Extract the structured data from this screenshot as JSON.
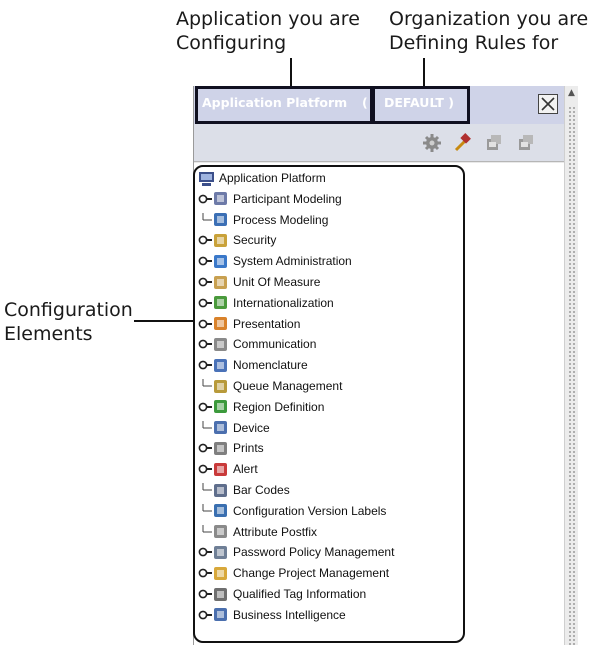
{
  "callouts": {
    "application_line1": "Application you are",
    "application_line2": "Configuring",
    "organization_line1": "Organization you are",
    "organization_line2": "Defining Rules for",
    "config_line1": "Configuration",
    "config_line2": "Elements"
  },
  "window": {
    "title_application": "Application Platform",
    "title_separator": "(",
    "title_organization": "DEFAULT )"
  },
  "toolbar": {
    "buttons": [
      "gear-icon",
      "hammer-icon",
      "save-icon",
      "save-as-icon"
    ]
  },
  "tree": {
    "root_label": "Application Platform",
    "items": [
      {
        "label": "Participant Modeling",
        "icon": "participant-icon",
        "expandable": true
      },
      {
        "label": "Process Modeling",
        "icon": "process-icon",
        "expandable": false
      },
      {
        "label": "Security",
        "icon": "security-icon",
        "expandable": true
      },
      {
        "label": "System Administration",
        "icon": "admin-icon",
        "expandable": true
      },
      {
        "label": "Unit Of Measure",
        "icon": "measure-icon",
        "expandable": true
      },
      {
        "label": "Internationalization",
        "icon": "globe-icon",
        "expandable": true
      },
      {
        "label": "Presentation",
        "icon": "presentation-icon",
        "expandable": true
      },
      {
        "label": "Communication",
        "icon": "communication-icon",
        "expandable": true
      },
      {
        "label": "Nomenclature",
        "icon": "nomenclature-icon",
        "expandable": true
      },
      {
        "label": "Queue Management",
        "icon": "queue-icon",
        "expandable": false
      },
      {
        "label": "Region Definition",
        "icon": "region-icon",
        "expandable": true
      },
      {
        "label": "Device",
        "icon": "device-icon",
        "expandable": false
      },
      {
        "label": "Prints",
        "icon": "printer-icon",
        "expandable": true
      },
      {
        "label": "Alert",
        "icon": "alert-icon",
        "expandable": true
      },
      {
        "label": "Bar Codes",
        "icon": "barcode-icon",
        "expandable": false
      },
      {
        "label": "Configuration Version Labels",
        "icon": "version-icon",
        "expandable": false
      },
      {
        "label": "Attribute Postfix",
        "icon": "postfix-icon",
        "expandable": false
      },
      {
        "label": "Password Policy Management",
        "icon": "password-icon",
        "expandable": true
      },
      {
        "label": "Change Project Management",
        "icon": "project-icon",
        "expandable": true
      },
      {
        "label": "Qualified Tag Information",
        "icon": "tag-icon",
        "expandable": true
      },
      {
        "label": "Business Intelligence",
        "icon": "bi-icon",
        "expandable": true
      }
    ]
  },
  "colors": {
    "title_bar": "#cfd3e8",
    "highlight": "#111111"
  }
}
